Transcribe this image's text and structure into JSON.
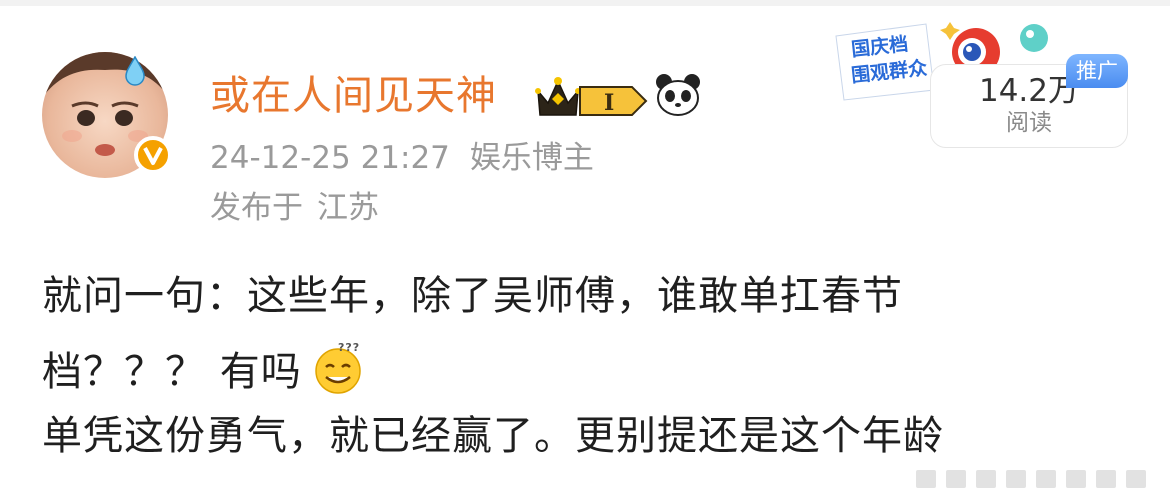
{
  "post": {
    "author_name": "或在人间见天神",
    "time": "24-12-25 21:27",
    "author_role": "娱乐博主",
    "location_prefix": "发布于",
    "location": "江苏",
    "level_badge": "I",
    "read_count": "14.2万",
    "read_label": "阅读",
    "ad_tag": "推广",
    "promo_text_line1": "国庆档",
    "promo_text_line2": "围观群众",
    "content_line1": "就问一句：这些年，除了吴师傅，谁敢单扛春节",
    "content_line2": "档？？？ 有吗",
    "content_line3": "单凭这份勇气，就已经赢了。更别提还是这个年龄"
  },
  "colors": {
    "author_name": "#e8772e",
    "meta": "#9a9a9a",
    "content": "#1f1f1f",
    "verified_badge": "#f5a100",
    "ad_tag": "#4a8cf0"
  },
  "icons": [
    "sweat-drop-icon",
    "verified-v-icon",
    "crown-icon",
    "panda-icon",
    "thinking-emoji-icon"
  ]
}
